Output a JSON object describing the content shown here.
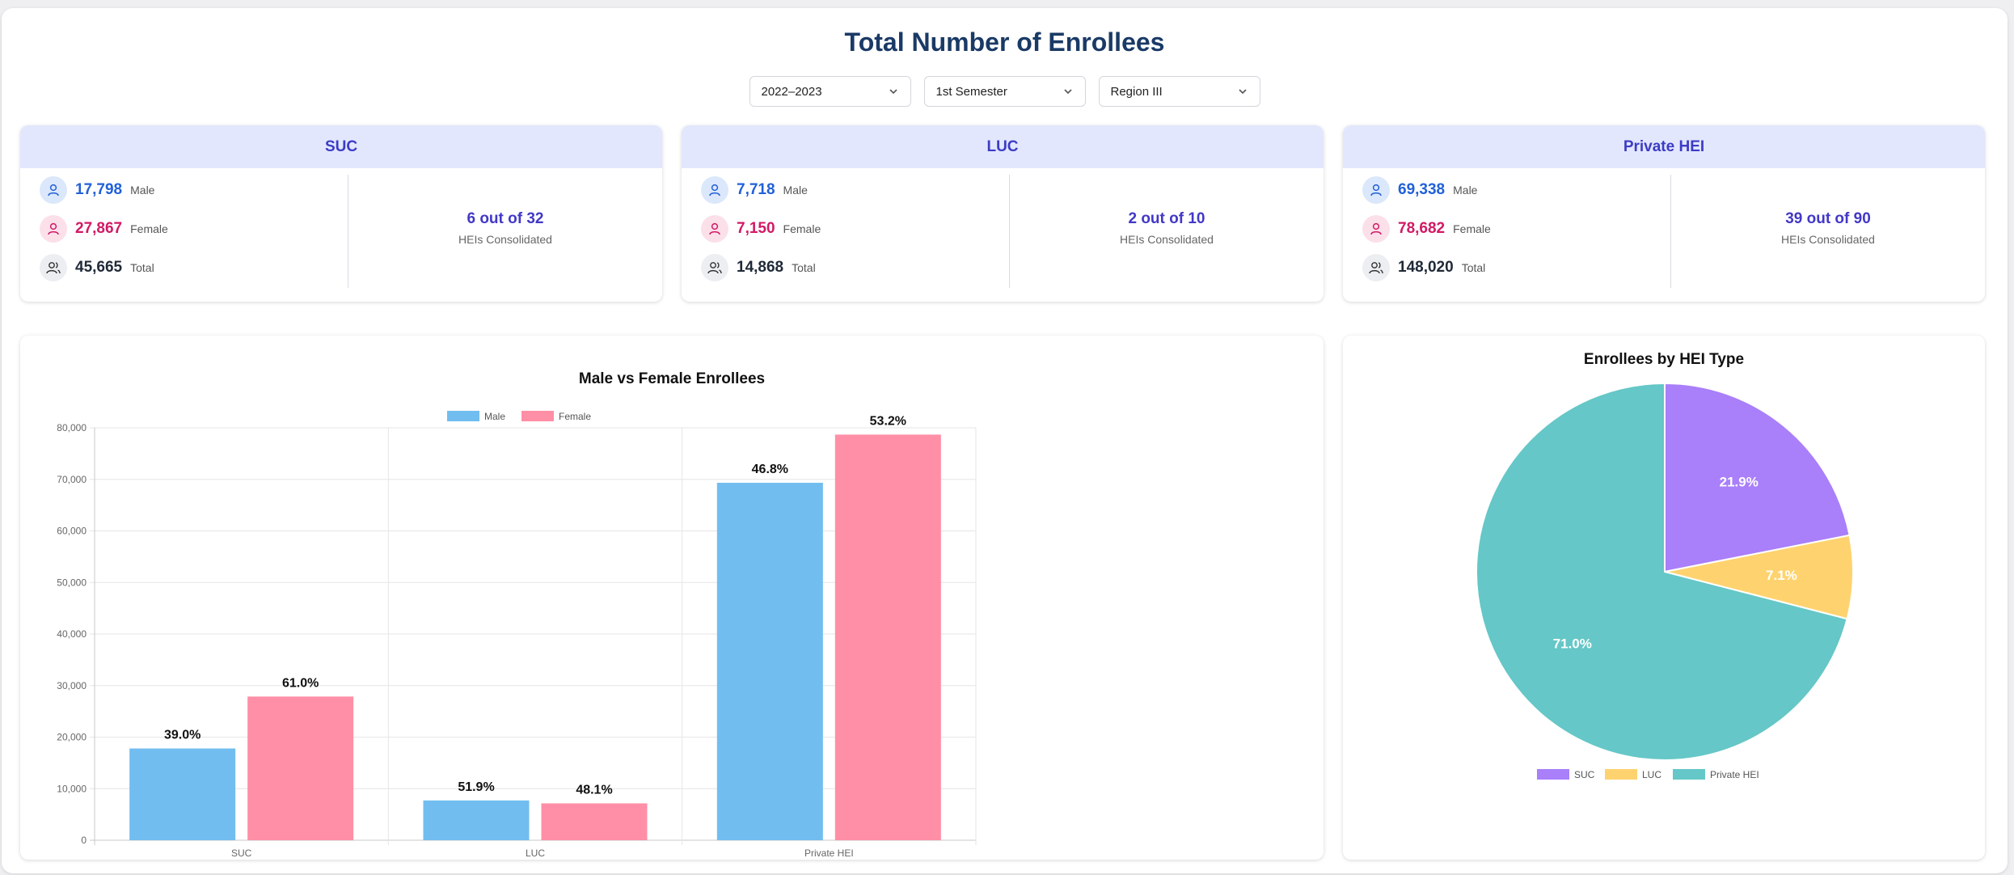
{
  "page_title": "Total Number of Enrollees",
  "filters": {
    "academic_year": "2022–2023",
    "semester": "1st Semester",
    "region": "Region III"
  },
  "cards": [
    {
      "title": "SUC",
      "male": "17,798",
      "male_label": "Male",
      "female": "27,867",
      "female_label": "Female",
      "total": "45,665",
      "total_label": "Total",
      "consolidated": "6 out of 32",
      "consolidated_label": "HEIs Consolidated"
    },
    {
      "title": "LUC",
      "male": "7,718",
      "male_label": "Male",
      "female": "7,150",
      "female_label": "Female",
      "total": "14,868",
      "total_label": "Total",
      "consolidated": "2 out of 10",
      "consolidated_label": "HEIs Consolidated"
    },
    {
      "title": "Private HEI",
      "male": "69,338",
      "male_label": "Male",
      "female": "78,682",
      "female_label": "Female",
      "total": "148,020",
      "total_label": "Total",
      "consolidated": "39 out of 90",
      "consolidated_label": "HEIs Consolidated"
    }
  ],
  "colors": {
    "male": "#72bdf0",
    "female": "#ff8fa6",
    "suc": "#a97ffa",
    "luc": "#fed36f",
    "private": "#65c7c7"
  },
  "chart_data": [
    {
      "type": "bar",
      "title": "Male vs Female Enrollees",
      "categories": [
        "SUC",
        "LUC",
        "Private HEI"
      ],
      "series": [
        {
          "name": "Male",
          "values": [
            17798,
            7718,
            69338
          ],
          "labels": [
            "39.0%",
            "51.9%",
            "46.8%"
          ]
        },
        {
          "name": "Female",
          "values": [
            27867,
            7150,
            78682
          ],
          "labels": [
            "61.0%",
            "48.1%",
            "53.2%"
          ]
        }
      ],
      "ylim": [
        0,
        80000
      ],
      "yticks": [
        "0",
        "10,000",
        "20,000",
        "30,000",
        "40,000",
        "50,000",
        "60,000",
        "70,000",
        "80,000"
      ],
      "grid": true,
      "legend": "top"
    },
    {
      "type": "pie",
      "title": "Enrollees by HEI Type",
      "categories": [
        "SUC",
        "LUC",
        "Private HEI"
      ],
      "values": [
        45665,
        14868,
        148020
      ],
      "labels": [
        "21.9%",
        "7.1%",
        "71.0%"
      ],
      "legend": "bottom"
    }
  ]
}
